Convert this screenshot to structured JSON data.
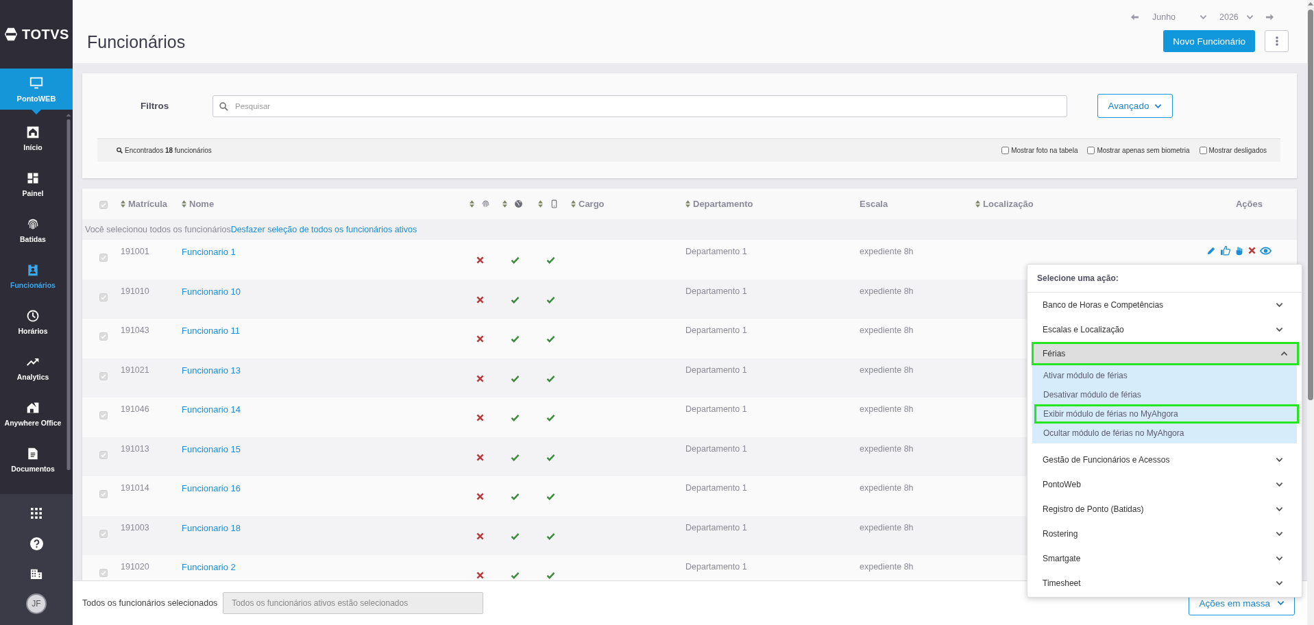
{
  "sidebar": {
    "logo": "TOTVS",
    "module": {
      "label": "PontoWEB",
      "selected": true
    },
    "items": [
      {
        "label": "Início",
        "selected": false
      },
      {
        "label": "Painel",
        "selected": false
      },
      {
        "label": "Batidas",
        "selected": false
      },
      {
        "label": "Funcionários",
        "selected": true
      },
      {
        "label": "Horários",
        "selected": false
      },
      {
        "label": "Analytics",
        "selected": false
      },
      {
        "label": "Anywhere Office",
        "selected": false
      },
      {
        "label": "Documentos",
        "selected": false
      }
    ],
    "avatar": "JF"
  },
  "header": {
    "title": "Funcionários",
    "month": "Junho",
    "year": "2026",
    "new_button": "Novo Funcionário"
  },
  "filters": {
    "label": "Filtros",
    "search_placeholder": "Pesquisar",
    "advanced_button": "Avançado",
    "found": "Encontrados **18** funcionários",
    "options": [
      {
        "label": "Mostrar foto na tabela",
        "checked": false
      },
      {
        "label": "Mostrar apenas sem biometria",
        "checked": false
      },
      {
        "label": "Mostrar desligados",
        "checked": false
      }
    ]
  },
  "table": {
    "all_selected": true,
    "columns": [
      {
        "kind": "text",
        "label": "Matrícula",
        "sortable": true
      },
      {
        "kind": "text",
        "label": "Nome",
        "sortable": true
      },
      {
        "kind": "icon",
        "sortable": true
      },
      {
        "kind": "icon",
        "sortable": true
      },
      {
        "kind": "icon",
        "sortable": true
      },
      {
        "kind": "text",
        "label": "Cargo",
        "sortable": true
      },
      {
        "kind": "text",
        "label": "Departamento",
        "sortable": true
      },
      {
        "kind": "text",
        "label": "Escala",
        "sortable": false
      },
      {
        "kind": "text",
        "label": "Localização",
        "sortable": true
      },
      {
        "kind": "actions",
        "label": "Ações",
        "sortable": false
      }
    ],
    "selection_notice": "Você selecionou todos os funcionários",
    "undo_link": "Desfazer seleção de todos os funcionários ativos",
    "rows": [
      {
        "selected": true,
        "hovered": true,
        "matricula": "191001",
        "nome": "Funcionario 1",
        "biometria": false,
        "web": true,
        "app": true,
        "departamento": "Departamento 1",
        "escala": "expediente 8h"
      },
      {
        "selected": true,
        "hovered": false,
        "matricula": "191010",
        "nome": "Funcionario 10",
        "biometria": false,
        "web": true,
        "app": true,
        "departamento": "Departamento 1",
        "escala": "expediente 8h"
      },
      {
        "selected": true,
        "hovered": false,
        "matricula": "191043",
        "nome": "Funcionario 11",
        "biometria": false,
        "web": true,
        "app": true,
        "departamento": "Departamento 1",
        "escala": "expediente 8h"
      },
      {
        "selected": true,
        "hovered": false,
        "matricula": "191021",
        "nome": "Funcionario 13",
        "biometria": false,
        "web": true,
        "app": true,
        "departamento": "Departamento 1",
        "escala": "expediente 8h"
      },
      {
        "selected": true,
        "hovered": false,
        "matricula": "191046",
        "nome": "Funcionario 14",
        "biometria": false,
        "web": true,
        "app": true,
        "departamento": "Departamento 1",
        "escala": "expediente 8h"
      },
      {
        "selected": true,
        "hovered": false,
        "matricula": "191013",
        "nome": "Funcionario 15",
        "biometria": false,
        "web": true,
        "app": true,
        "departamento": "Departamento 1",
        "escala": "expediente 8h"
      },
      {
        "selected": true,
        "hovered": false,
        "matricula": "191014",
        "nome": "Funcionario 16",
        "biometria": false,
        "web": true,
        "app": true,
        "departamento": "Departamento 1",
        "escala": "expediente 8h"
      },
      {
        "selected": true,
        "hovered": false,
        "matricula": "191003",
        "nome": "Funcionario 18",
        "biometria": false,
        "web": true,
        "app": true,
        "departamento": "Departamento 1",
        "escala": "expediente 8h"
      },
      {
        "selected": true,
        "hovered": false,
        "matricula": "191020",
        "nome": "Funcionario 2",
        "biometria": false,
        "web": true,
        "app": true,
        "departamento": "Departamento 1",
        "escala": "expediente 8h"
      }
    ]
  },
  "action_menu": {
    "title": "Selecione uma ação:",
    "groups": [
      {
        "label": "Banco de Horas e Competências",
        "expanded": false,
        "highlighted": false
      },
      {
        "label": "Escalas e Localização",
        "expanded": false,
        "highlighted": false
      },
      {
        "label": "Férias",
        "expanded": true,
        "highlighted": true,
        "actions": [
          {
            "label": "Ativar módulo de férias",
            "highlighted": false
          },
          {
            "label": "Desativar módulo de férias",
            "highlighted": false
          },
          {
            "label": "Exibir módulo de férias no MyAhgora",
            "highlighted": true
          },
          {
            "label": "Ocultar módulo de férias no MyAhgora",
            "highlighted": false
          }
        ]
      },
      {
        "label": "Gestão de Funcionários e Acessos",
        "expanded": false,
        "highlighted": false
      },
      {
        "label": "PontoWeb",
        "expanded": false,
        "highlighted": false
      },
      {
        "label": "Registro de Ponto (Batidas)",
        "expanded": false,
        "highlighted": false
      },
      {
        "label": "Rostering",
        "expanded": false,
        "highlighted": false
      },
      {
        "label": "Smartgate",
        "expanded": false,
        "highlighted": false
      },
      {
        "label": "Timesheet",
        "expanded": false,
        "highlighted": false
      }
    ]
  },
  "footer": {
    "label": "Todos os funcionários selecionados",
    "field_value": "Todos os funcionários ativos estão selecionados",
    "mass_button": "Ações em massa"
  }
}
